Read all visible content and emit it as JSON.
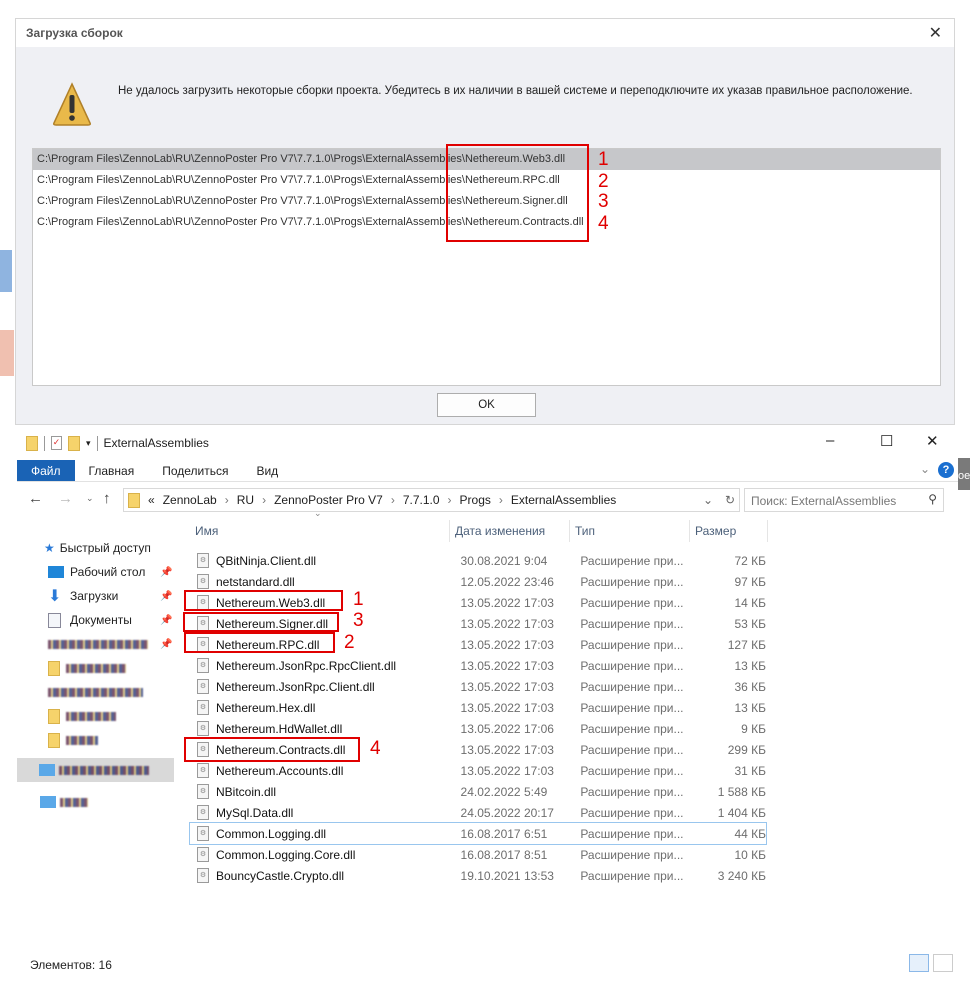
{
  "dialog": {
    "title": "Загрузка сборок",
    "message": "Не удалось загрузить некоторые сборки проекта. Убедитесь в их наличии в вашей системе и переподключите их указав правильное расположение.",
    "items": [
      "C:\\Program Files\\ZennoLab\\RU\\ZennoPoster Pro V7\\7.7.1.0\\Progs\\ExternalAssemblies\\Nethereum.Web3.dll",
      "C:\\Program Files\\ZennoLab\\RU\\ZennoPoster Pro V7\\7.7.1.0\\Progs\\ExternalAssemblies\\Nethereum.RPC.dll",
      "C:\\Program Files\\ZennoLab\\RU\\ZennoPoster Pro V7\\7.7.1.0\\Progs\\ExternalAssemblies\\Nethereum.Signer.dll",
      "C:\\Program Files\\ZennoLab\\RU\\ZennoPoster Pro V7\\7.7.1.0\\Progs\\ExternalAssemblies\\Nethereum.Contracts.dll"
    ],
    "annotations": [
      "1",
      "2",
      "3",
      "4"
    ],
    "ok_label": "OK"
  },
  "explorer": {
    "title": "ExternalAssemblies",
    "ribbon_tabs": [
      "Файл",
      "Главная",
      "Поделиться",
      "Вид"
    ],
    "breadcrumb": [
      "«",
      "ZennoLab",
      "RU",
      "ZennoPoster Pro V7",
      "7.7.1.0",
      "Progs",
      "ExternalAssemblies"
    ],
    "search_placeholder": "Поиск: ExternalAssemblies",
    "columns": [
      "Имя",
      "Дата изменения",
      "Тип",
      "Размер"
    ],
    "sidebar": [
      "Быстрый доступ",
      "Рабочий стол",
      "Загрузки",
      "Документы"
    ],
    "files": [
      {
        "name": "QBitNinja.Client.dll",
        "date": "30.08.2021 9:04",
        "type": "Расширение при...",
        "size": "72 КБ"
      },
      {
        "name": "netstandard.dll",
        "date": "12.05.2022 23:46",
        "type": "Расширение при...",
        "size": "97 КБ"
      },
      {
        "name": "Nethereum.Web3.dll",
        "date": "13.05.2022 17:03",
        "type": "Расширение при...",
        "size": "14 КБ"
      },
      {
        "name": "Nethereum.Signer.dll",
        "date": "13.05.2022 17:03",
        "type": "Расширение при...",
        "size": "53 КБ"
      },
      {
        "name": "Nethereum.RPC.dll",
        "date": "13.05.2022 17:03",
        "type": "Расширение при...",
        "size": "127 КБ"
      },
      {
        "name": "Nethereum.JsonRpc.RpcClient.dll",
        "date": "13.05.2022 17:03",
        "type": "Расширение при...",
        "size": "13 КБ"
      },
      {
        "name": "Nethereum.JsonRpc.Client.dll",
        "date": "13.05.2022 17:03",
        "type": "Расширение при...",
        "size": "36 КБ"
      },
      {
        "name": "Nethereum.Hex.dll",
        "date": "13.05.2022 17:03",
        "type": "Расширение при...",
        "size": "13 КБ"
      },
      {
        "name": "Nethereum.HdWallet.dll",
        "date": "13.05.2022 17:06",
        "type": "Расширение при...",
        "size": "9 КБ"
      },
      {
        "name": "Nethereum.Contracts.dll",
        "date": "13.05.2022 17:03",
        "type": "Расширение при...",
        "size": "299 КБ"
      },
      {
        "name": "Nethereum.Accounts.dll",
        "date": "13.05.2022 17:03",
        "type": "Расширение при...",
        "size": "31 КБ"
      },
      {
        "name": "NBitcoin.dll",
        "date": "24.02.2022 5:49",
        "type": "Расширение при...",
        "size": "1 588 КБ"
      },
      {
        "name": "MySql.Data.dll",
        "date": "24.05.2022 20:17",
        "type": "Расширение при...",
        "size": "1 404 КБ"
      },
      {
        "name": "Common.Logging.dll",
        "date": "16.08.2017 6:51",
        "type": "Расширение при...",
        "size": "44 КБ"
      },
      {
        "name": "Common.Logging.Core.dll",
        "date": "16.08.2017 8:51",
        "type": "Расширение при...",
        "size": "10 КБ"
      },
      {
        "name": "BouncyCastle.Crypto.dll",
        "date": "19.10.2021 13:53",
        "type": "Расширение при...",
        "size": "3 240 КБ"
      }
    ],
    "annotations": {
      "web3": "1",
      "signer": "3",
      "rpc": "2",
      "contracts": "4"
    },
    "status": "Элементов: 16"
  },
  "background": {
    "right_text": "ое"
  }
}
